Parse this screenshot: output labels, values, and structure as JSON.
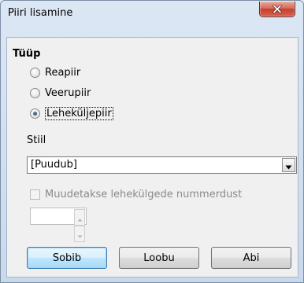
{
  "window": {
    "title": "Piiri lisamine"
  },
  "section": {
    "label": "Tüüp",
    "options": [
      {
        "label": "Reapiir",
        "checked": false
      },
      {
        "label": "Veerupiir",
        "checked": false
      },
      {
        "label": "Leheküljepiir",
        "checked": true
      }
    ]
  },
  "style": {
    "label": "Stiil",
    "value": "[Puudub]"
  },
  "numbering": {
    "checkbox_label": "Muudetakse lehekülgede nummerdust",
    "checked": false,
    "enabled": false,
    "value": ""
  },
  "buttons": {
    "ok": "Sobib",
    "cancel": "Loobu",
    "help": "Abi"
  },
  "icons": {
    "close": "close-icon",
    "dropdown": "chevron-down-icon",
    "spin_up": "chevron-up-icon",
    "spin_down": "chevron-down-icon"
  }
}
